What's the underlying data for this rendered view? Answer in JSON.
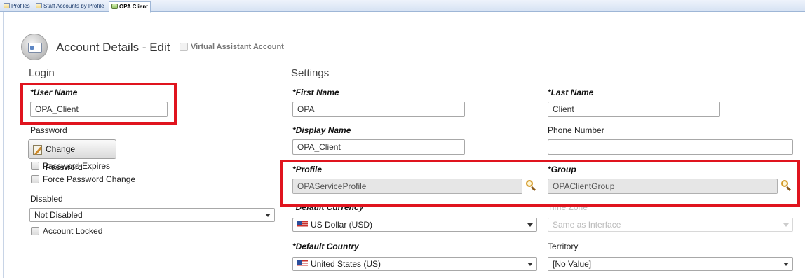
{
  "tabs": [
    {
      "label": "Profiles",
      "icon": "grid-icon"
    },
    {
      "label": "Staff Accounts by Profile",
      "icon": "grid-icon"
    },
    {
      "label": "OPA Client",
      "icon": "users-icon",
      "active": true
    }
  ],
  "header": {
    "title": "Account Details - Edit",
    "virtual_assistant_label": "Virtual Assistant Account",
    "icon": "account-card-icon"
  },
  "login": {
    "section_title": "Login",
    "user_name_label": "*User Name",
    "user_name_value": "OPA_Client",
    "password_label": "Password",
    "change_password_label": "Change Password",
    "password_expires_label": "Password Expires",
    "force_password_change_label": "Force Password Change",
    "disabled_label": "Disabled",
    "disabled_value": "Not Disabled",
    "account_locked_label": "Account Locked"
  },
  "settings": {
    "section_title": "Settings",
    "first_name_label": "*First Name",
    "first_name_value": "OPA",
    "last_name_label": "*Last Name",
    "last_name_value": "Client",
    "display_name_label": "*Display Name",
    "display_name_value": "OPA_Client",
    "phone_label": "Phone Number",
    "phone_value": "",
    "profile_label": "*Profile",
    "profile_value": "OPAServiceProfile",
    "group_label": "*Group",
    "group_value": "OPAClientGroup",
    "currency_label": "*Default Currency",
    "currency_value": "US Dollar (USD)",
    "timezone_label": "Time Zone",
    "timezone_value": "Same as Interface",
    "country_label": "*Default Country",
    "country_value": "United States (US)",
    "territory_label": "Territory",
    "territory_value": "[No Value]"
  },
  "colors": {
    "highlight": "#e0141e",
    "tab_bar": "#d6e2f3"
  }
}
